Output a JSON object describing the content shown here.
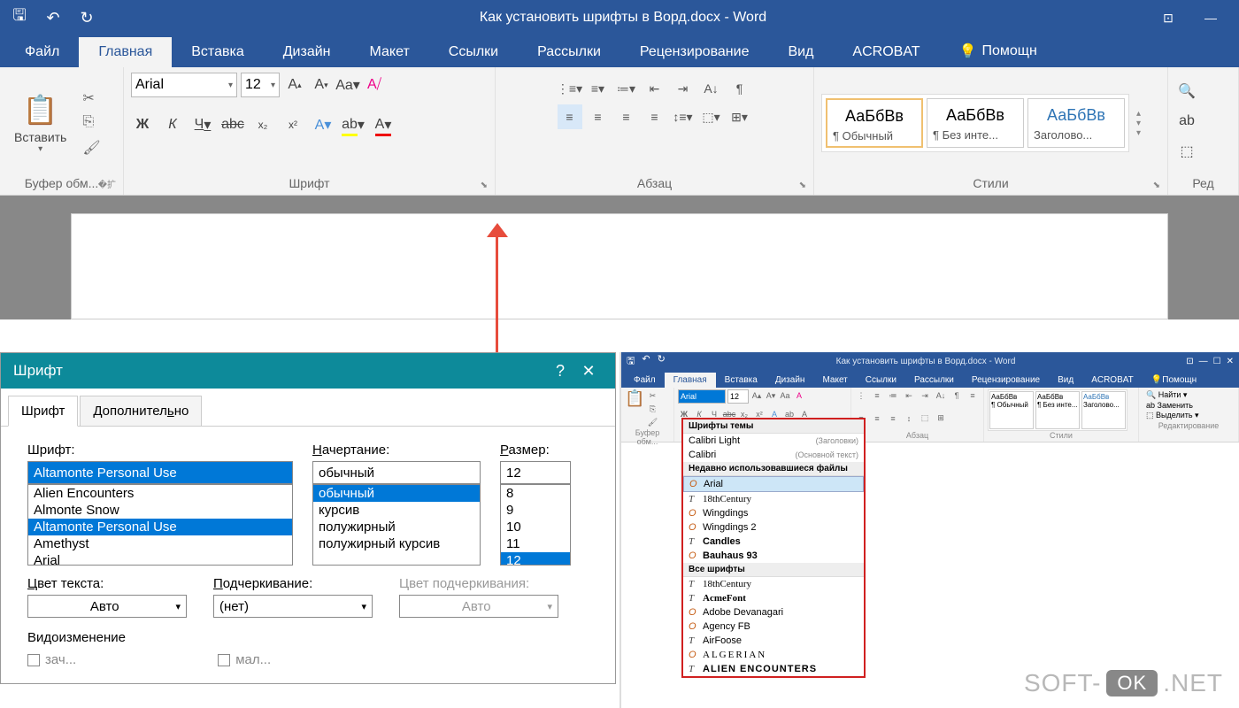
{
  "title_bar": {
    "document_title": "Как установить шрифты в Ворд.docx - Word"
  },
  "tabs": {
    "file": "Файл",
    "home": "Главная",
    "insert": "Вставка",
    "design": "Дизайн",
    "layout": "Макет",
    "references": "Ссылки",
    "mailings": "Рассылки",
    "review": "Рецензирование",
    "view": "Вид",
    "acrobat": "ACROBAT",
    "help": "Помощн"
  },
  "ribbon": {
    "clipboard": {
      "paste": "Вставить",
      "label": "Буфер обм..."
    },
    "font": {
      "name": "Arial",
      "size": "12",
      "bold": "Ж",
      "italic": "К",
      "underline": "Ч",
      "strike": "abc",
      "sub": "x₂",
      "sup": "x²",
      "label": "Шрифт"
    },
    "paragraph": {
      "label": "Абзац"
    },
    "styles": {
      "label": "Стили",
      "preview": "АаБбВв",
      "s1": "¶ Обычный",
      "s2": "¶ Без инте...",
      "s3": "Заголово..."
    },
    "editing": {
      "label": "Ред"
    }
  },
  "font_dialog": {
    "title": "Шрифт",
    "tab_font": "Шрифт",
    "tab_advanced": "Дополнительно",
    "lbl_font": "Шрифт:",
    "lbl_style": "Начертание:",
    "lbl_size": "Размер:",
    "font_value": "Altamonte Personal Use",
    "style_value": "обычный",
    "size_value": "12",
    "font_list": [
      "Alien Encounters",
      "Almonte Snow",
      "Altamonte Personal Use",
      "Amethyst",
      "Arial"
    ],
    "style_list": [
      "обычный",
      "курсив",
      "полужирный",
      "полужирный курсив"
    ],
    "size_list": [
      "8",
      "9",
      "10",
      "11",
      "12"
    ],
    "lbl_color": "Цвет текста:",
    "lbl_underline_style": "Подчеркивание:",
    "lbl_underline_color": "Цвет подчеркивания:",
    "color_auto": "Авто",
    "underline_none": "(нет)",
    "section_effects": "Видоизменение",
    "ck_strike": "зачеркнутый",
    "ck_smallcaps": "малые прописные"
  },
  "small_word": {
    "title": "Как установить шрифты в Ворд.docx - Word",
    "font_value": "Arial",
    "size_value": "12",
    "edit_find": "Найти",
    "edit_replace": "Заменить",
    "edit_select": "Выделить",
    "edit_label": "Редактирование"
  },
  "font_dropdown": {
    "section_theme": "Шрифты темы",
    "theme_items": [
      {
        "name": "Calibri Light",
        "hint": "(Заголовки)"
      },
      {
        "name": "Calibri",
        "hint": "(Основной текст)"
      }
    ],
    "section_recent": "Недавно использовавшиеся файлы",
    "recent_items": [
      "Arial",
      "18thCentury",
      "Wingdings",
      "Wingdings 2",
      "Candles",
      "Bauhaus 93"
    ],
    "section_all": "Все шрифты",
    "all_items": [
      "18thCentury",
      "AcmeFont",
      "Adobe Devanagari",
      "Agency FB",
      "AirFoose",
      "ALGERIAN",
      "ALIEN ENCOUNTERS"
    ]
  },
  "watermark": {
    "a": "SOFT-",
    "b": "OK",
    "c": ".NET"
  }
}
